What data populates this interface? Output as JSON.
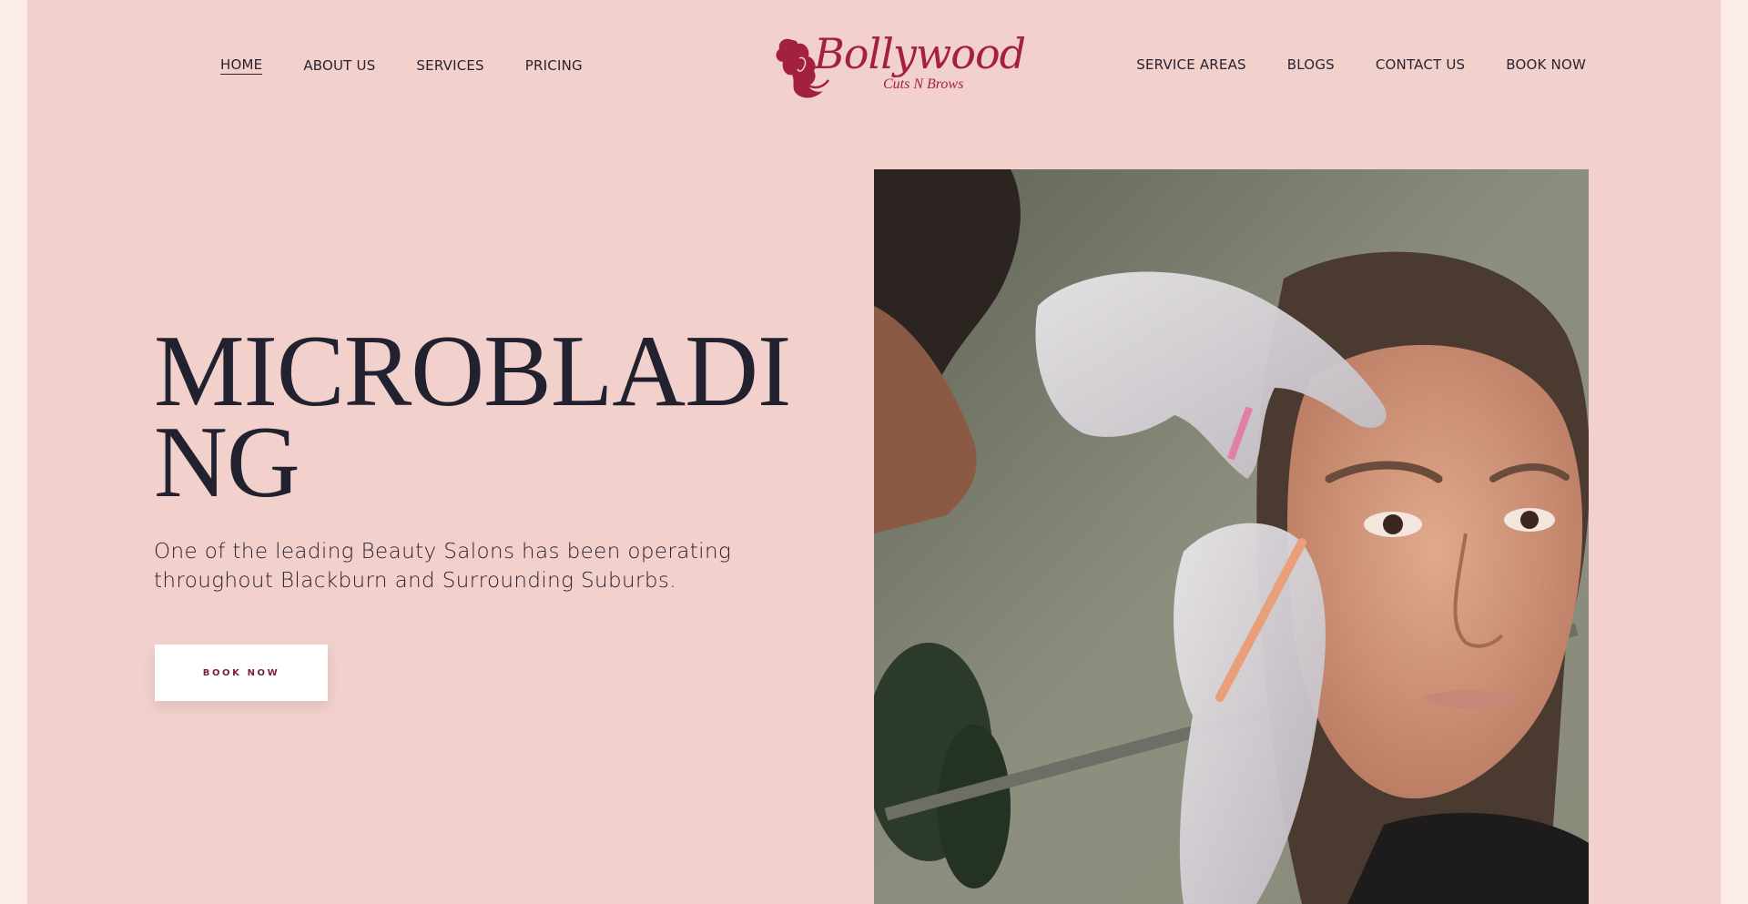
{
  "nav": {
    "left": [
      {
        "label": "HOME",
        "active": true
      },
      {
        "label": "ABOUT US"
      },
      {
        "label": "SERVICES"
      },
      {
        "label": "PRICING"
      }
    ],
    "right": [
      {
        "label": "SERVICE AREAS"
      },
      {
        "label": "BLOGS"
      },
      {
        "label": "CONTACT US"
      },
      {
        "label": "BOOK NOW"
      }
    ]
  },
  "logo": {
    "word": "Bollywood",
    "sub": "Cuts N Brows",
    "color": "#a3213f",
    "icon": "woman-silhouette-icon"
  },
  "hero": {
    "title": "MICROBLADING",
    "subtitle": "One of the leading Beauty Salons has been operating throughout Blackburn and Surrounding Suburbs.",
    "button": "BOOK NOW",
    "image": "microblading-procedure-photo"
  },
  "colors": {
    "background": "#f2d1cd",
    "outer": "#fbecea",
    "text": "#22212f",
    "accent": "#a3213f"
  }
}
